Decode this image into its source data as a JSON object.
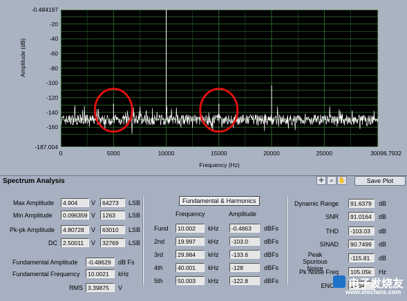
{
  "chart_data": {
    "type": "line",
    "title": "",
    "xlabel": "Frequency (Hz)",
    "ylabel": "Amplitude (dB)",
    "xlim": [
      0,
      30096.7932
    ],
    "ylim": [
      -187.004,
      -0.484197
    ],
    "x_ticks": [
      "0",
      "5000",
      "10000",
      "15000",
      "20000",
      "25000",
      "30096.7932"
    ],
    "y_ticks": [
      "-0.484197",
      "-20",
      "-40",
      "-60",
      "-80",
      "-100",
      "-120",
      "-140",
      "-160",
      "-187.004"
    ],
    "grid": true,
    "series": [
      {
        "color": "#ffffff",
        "noise_floor_db": -150,
        "peaks": [
          {
            "x": 10002,
            "y": -0.4863
          },
          {
            "x": 20004,
            "y": -103.0
          },
          {
            "x": 5000,
            "y": -128
          },
          {
            "x": 15000,
            "y": -128
          }
        ]
      }
    ],
    "annotations": [
      {
        "shape": "ellipse",
        "color": "#e01010",
        "center_x": 5000,
        "center_y": -137
      },
      {
        "shape": "ellipse",
        "color": "#e01010",
        "center_x": 15000,
        "center_y": -137
      }
    ]
  },
  "panel": {
    "title": "Spectrum  Analysis",
    "save_plot": "Save Plot",
    "left": [
      {
        "label": "Max Amplitude",
        "v": "4.904",
        "unit_v": "V",
        "lsb": "64273",
        "unit_lsb": "LSB"
      },
      {
        "label": "Min Amplitude",
        "v": "0.096359",
        "unit_v": "V",
        "lsb": "1263",
        "unit_lsb": "LSB"
      },
      {
        "label": "Pk-pk Amplitude",
        "v": "4.80728",
        "unit_v": "V",
        "lsb": "63010",
        "unit_lsb": "LSB"
      },
      {
        "label": "DC",
        "v": "2.50011",
        "unit_v": "V",
        "lsb": "32769",
        "unit_lsb": "LSB"
      }
    ],
    "fund_amp": {
      "label": "Fundamental Amplitude",
      "value": "-0.48629",
      "unit": "dB Fs"
    },
    "fund_freq": {
      "label": "Fundamental Frequency",
      "value": "10.0021",
      "unit": "kHz"
    },
    "rms": {
      "label": "RMS",
      "value": "3.39875",
      "unit": "V"
    },
    "harmonics": {
      "header": "Fundamental & Harmonics",
      "col_freq": "Frequency",
      "col_amp": "Amplitude",
      "freq_unit": "kHz",
      "amp_unit": "dBFs",
      "rows": [
        {
          "name": "Fund",
          "freq": "10.002",
          "amp": "-0.4863"
        },
        {
          "name": "2nd",
          "freq": "19.997",
          "amp": "-103.0"
        },
        {
          "name": "3rd",
          "freq": "29.984",
          "amp": "-133.6"
        },
        {
          "name": "4th",
          "freq": "40.001",
          "amp": "-128"
        },
        {
          "name": "5th",
          "freq": "50.003",
          "amp": "-122.8"
        }
      ]
    },
    "right": [
      {
        "label": "Dynamic Range",
        "value": "91.6379",
        "unit": "dB"
      },
      {
        "label": "SNR",
        "value": "91.0164",
        "unit": "dB"
      },
      {
        "label": "THD",
        "value": "-103.03",
        "unit": "dB"
      },
      {
        "label": "SINAD",
        "value": "90.7499",
        "unit": "dB"
      },
      {
        "label": "Peak Spurious Noise",
        "value": "-115.81",
        "unit": "dB"
      },
      {
        "label": "Pk Noise Freq",
        "value": "105.05k",
        "unit": "Hz"
      },
      {
        "label": "ENOB",
        "value": "14.94",
        "unit": ""
      }
    ],
    "watermark_line1": "电子发烧友",
    "watermark_line2": "www.elecfans.com"
  }
}
